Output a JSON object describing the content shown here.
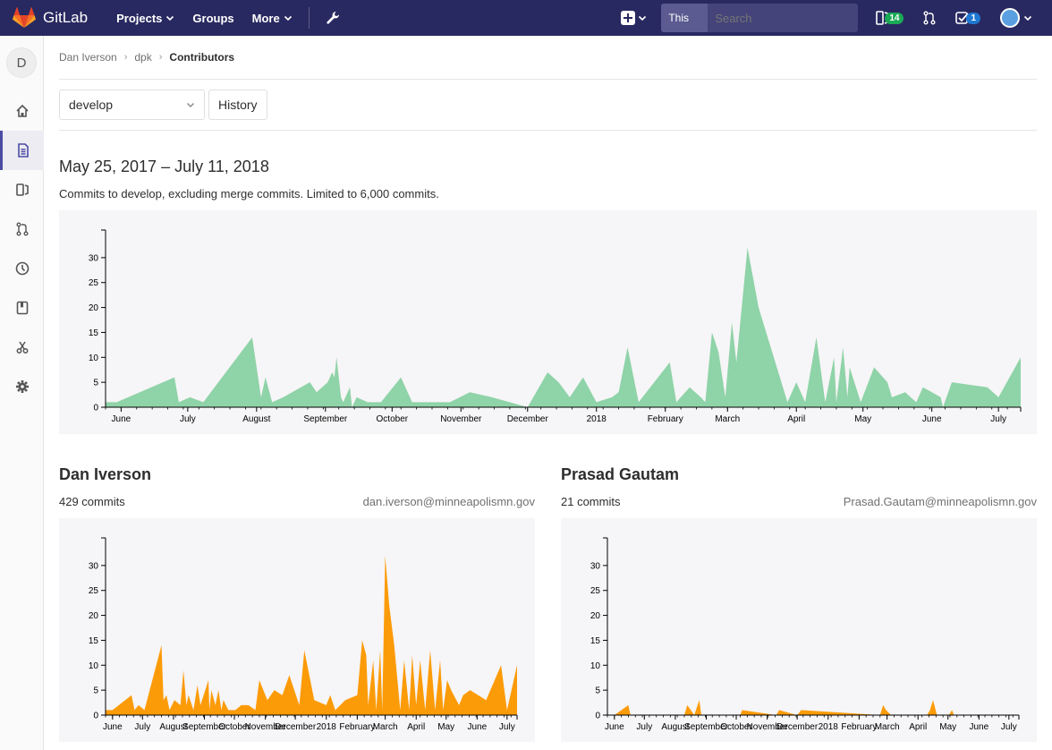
{
  "navbar": {
    "brand": "GitLab",
    "links": [
      "Projects",
      "Groups",
      "More"
    ],
    "search_scope": "This project",
    "search_placeholder": "Search",
    "issues_count": "14",
    "todos_count": "1"
  },
  "sidebar": {
    "avatar_letter": "D",
    "items": [
      "home-icon",
      "repository-icon",
      "issues-icon",
      "merge-requests-icon",
      "ci-cd-icon",
      "wiki-icon",
      "snippets-icon",
      "settings-icon"
    ]
  },
  "breadcrumb": {
    "items": [
      "Dan Iverson",
      "dpk",
      "Contributors"
    ]
  },
  "controls": {
    "branch": "develop",
    "history_label": "History"
  },
  "summary": {
    "title": "May 25, 2017 – July 11, 2018",
    "subtitle": "Commits to develop, excluding merge commits. Limited to 6,000 commits."
  },
  "colors": {
    "main_fill": "#8fd3a8",
    "contributor_fill": "#fc9b08",
    "chart_bg": "#f6f5f7",
    "navbar": "#292961"
  },
  "chart_data": [
    {
      "type": "area",
      "name": "commits-overall",
      "x": [
        "2017-05-25",
        "2017-05-30",
        "2017-06-25",
        "2017-06-27",
        "2017-07-02",
        "2017-07-08",
        "2017-07-30",
        "2017-08-03",
        "2017-08-05",
        "2017-08-08",
        "2017-08-13",
        "2017-08-25",
        "2017-08-28",
        "2017-09-02",
        "2017-09-04",
        "2017-09-05",
        "2017-09-06",
        "2017-09-08",
        "2017-09-09",
        "2017-09-12",
        "2017-09-13",
        "2017-09-15",
        "2017-09-20",
        "2017-09-25",
        "2017-09-26",
        "2017-10-05",
        "2017-10-10",
        "2017-10-15",
        "2017-10-25",
        "2017-10-27",
        "2017-11-05",
        "2017-11-15",
        "2017-12-01",
        "2017-12-10",
        "2017-12-15",
        "2017-12-20",
        "2017-12-26",
        "2018-01-01",
        "2018-01-08",
        "2018-01-11",
        "2018-01-15",
        "2018-01-20",
        "2018-02-03",
        "2018-02-06",
        "2018-02-12",
        "2018-02-17",
        "2018-02-19",
        "2018-02-22",
        "2018-02-25",
        "2018-02-28",
        "2018-03-03",
        "2018-03-05",
        "2018-03-10",
        "2018-03-15",
        "2018-03-28",
        "2018-04-01",
        "2018-04-05",
        "2018-04-10",
        "2018-04-14",
        "2018-04-18",
        "2018-04-19",
        "2018-04-22",
        "2018-04-24",
        "2018-04-25",
        "2018-04-30",
        "2018-05-06",
        "2018-05-12",
        "2018-05-14",
        "2018-05-20",
        "2018-05-25",
        "2018-05-28",
        "2018-06-01",
        "2018-06-05",
        "2018-06-06",
        "2018-06-10",
        "2018-06-26",
        "2018-07-01",
        "2018-07-11"
      ],
      "y": [
        1,
        1,
        6,
        1,
        2,
        1,
        14,
        2,
        6,
        1,
        2,
        5,
        3,
        5,
        7,
        6,
        10,
        2,
        1,
        4,
        0,
        2,
        1,
        1,
        1,
        6,
        1,
        1,
        1,
        1,
        3,
        2,
        0,
        7,
        5,
        2,
        6,
        1,
        2,
        3,
        12,
        1,
        9,
        1,
        4,
        2,
        1,
        15,
        11,
        2,
        17,
        9,
        32,
        20,
        1,
        5,
        1,
        14,
        1,
        10,
        1,
        12,
        2,
        8,
        1,
        8,
        5,
        2,
        3,
        1,
        4,
        3,
        2,
        0,
        5,
        4,
        2,
        10
      ],
      "ylim": [
        0,
        35
      ],
      "yticks": [
        0,
        5,
        10,
        15,
        20,
        25,
        30
      ],
      "xticks": [
        "June",
        "July",
        "August",
        "September",
        "October",
        "November",
        "December",
        "2018",
        "February",
        "March",
        "April",
        "May",
        "June",
        "July"
      ]
    },
    {
      "type": "area",
      "name": "Dan Iverson",
      "commits": "429 commits",
      "email": "dan.iverson@minneapolismn.gov",
      "x": [
        "2017-05-25",
        "2017-06-01",
        "2017-06-20",
        "2017-06-23",
        "2017-06-27",
        "2017-07-03",
        "2017-07-20",
        "2017-07-22",
        "2017-07-25",
        "2017-07-28",
        "2017-08-02",
        "2017-08-08",
        "2017-08-11",
        "2017-08-14",
        "2017-08-16",
        "2017-08-21",
        "2017-08-25",
        "2017-08-28",
        "2017-09-05",
        "2017-09-06",
        "2017-09-08",
        "2017-09-12",
        "2017-09-15",
        "2017-09-18",
        "2017-09-20",
        "2017-09-25",
        "2017-10-02",
        "2017-10-08",
        "2017-10-15",
        "2017-10-22",
        "2017-10-26",
        "2017-11-03",
        "2017-11-10",
        "2017-11-18",
        "2017-11-25",
        "2017-12-05",
        "2017-12-10",
        "2017-12-20",
        "2018-01-01",
        "2018-01-05",
        "2018-01-10",
        "2018-01-15",
        "2018-01-20",
        "2018-02-01",
        "2018-02-06",
        "2018-02-10",
        "2018-02-12",
        "2018-02-17",
        "2018-02-20",
        "2018-02-24",
        "2018-02-26",
        "2018-03-01",
        "2018-03-05",
        "2018-03-10",
        "2018-03-16",
        "2018-03-20",
        "2018-03-25",
        "2018-03-28",
        "2018-04-01",
        "2018-04-05",
        "2018-04-10",
        "2018-04-15",
        "2018-04-20",
        "2018-04-25",
        "2018-04-28",
        "2018-05-02",
        "2018-05-06",
        "2018-05-14",
        "2018-05-18",
        "2018-05-25",
        "2018-06-10",
        "2018-06-25",
        "2018-07-01",
        "2018-07-11"
      ],
      "y": [
        1,
        1,
        4,
        1,
        2,
        1,
        14,
        3,
        4,
        1,
        3,
        2,
        9,
        2,
        4,
        1,
        6,
        2,
        7,
        1,
        5,
        2,
        5,
        1,
        3,
        1,
        1,
        2,
        2,
        1,
        7,
        3,
        5,
        4,
        8,
        2,
        13,
        3,
        2,
        4,
        1,
        2,
        3,
        4,
        15,
        12,
        2,
        11,
        1,
        13,
        1,
        32,
        22,
        14,
        1,
        11,
        1,
        12,
        2,
        11,
        1,
        13,
        1,
        11,
        1,
        7,
        5,
        2,
        4,
        5,
        3,
        10,
        1,
        10
      ],
      "ylim": [
        0,
        35
      ],
      "yticks": [
        0,
        5,
        10,
        15,
        20,
        25,
        30
      ],
      "xticks": [
        "June",
        "July",
        "August",
        "September",
        "October",
        "November",
        "December",
        "2018",
        "February",
        "March",
        "April",
        "May",
        "June",
        "July"
      ]
    },
    {
      "type": "area",
      "name": "Prasad Gautam",
      "commits": "21 commits",
      "email": "Prasad.Gautam@minneapolismn.gov",
      "x": [
        "2017-06-01",
        "2017-06-15",
        "2017-06-17",
        "2017-08-10",
        "2017-08-13",
        "2017-08-20",
        "2017-08-25",
        "2017-08-27",
        "2017-10-05",
        "2017-10-07",
        "2017-11-10",
        "2017-11-13",
        "2017-12-01",
        "2017-12-05",
        "2018-02-22",
        "2018-02-25",
        "2018-02-28",
        "2018-03-05",
        "2018-04-10",
        "2018-04-13",
        "2018-04-16",
        "2018-04-20",
        "2018-05-02",
        "2018-05-05",
        "2018-05-07"
      ],
      "y": [
        0,
        2,
        0,
        0,
        2,
        0,
        3,
        0,
        0,
        1,
        0,
        1,
        0,
        1,
        0,
        2,
        1,
        0,
        0,
        1,
        3,
        0,
        0,
        1,
        0
      ],
      "ylim": [
        0,
        35
      ],
      "yticks": [
        0,
        5,
        10,
        15,
        20,
        25,
        30
      ],
      "xticks": [
        "June",
        "July",
        "August",
        "September",
        "October",
        "November",
        "December",
        "2018",
        "February",
        "March",
        "April",
        "May",
        "June",
        "July"
      ]
    }
  ]
}
